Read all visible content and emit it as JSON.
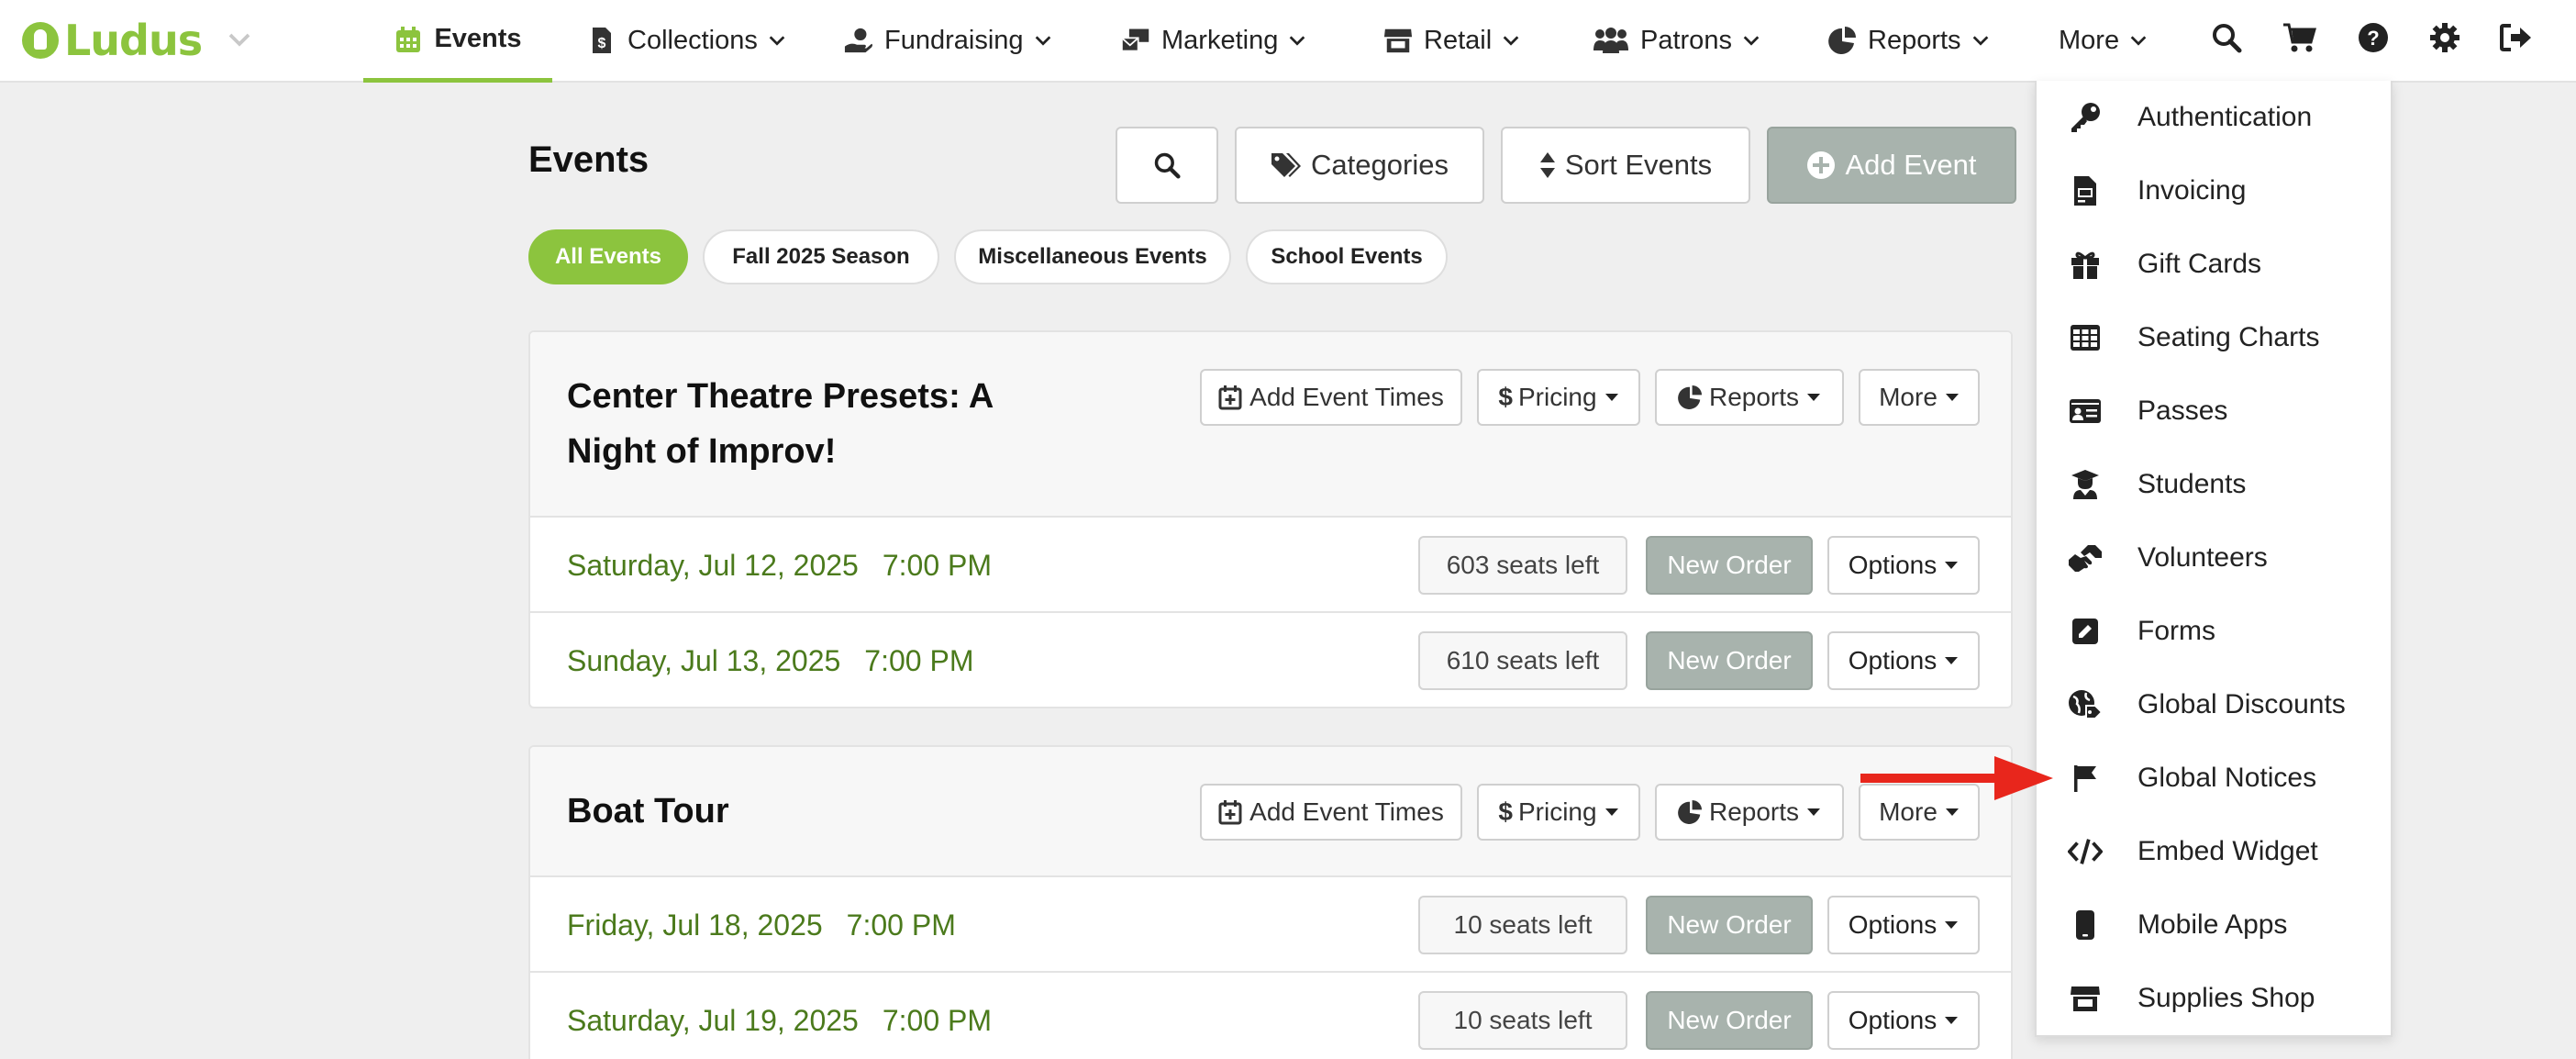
{
  "app": {
    "logo_text": "Ludus"
  },
  "nav": {
    "items": [
      {
        "label": "Events",
        "icon": "calendar-icon",
        "active": true
      },
      {
        "label": "Collections",
        "icon": "file-invoice-dollar-icon"
      },
      {
        "label": "Fundraising",
        "icon": "hand-holding-dollar-icon"
      },
      {
        "label": "Marketing",
        "icon": "mail-bulk-icon"
      },
      {
        "label": "Retail",
        "icon": "store-icon"
      },
      {
        "label": "Patrons",
        "icon": "users-icon"
      },
      {
        "label": "Reports",
        "icon": "chart-pie-icon"
      },
      {
        "label": "More"
      }
    ],
    "right_icons": [
      "search-icon",
      "cart-icon",
      "help-icon",
      "gear-icon",
      "sign-out-icon"
    ]
  },
  "main": {
    "title": "Events",
    "toolbar": {
      "categories": "Categories",
      "sort": "Sort Events",
      "add": "Add Event"
    },
    "filters": [
      "All Events",
      "Fall 2025 Season",
      "Miscellaneous Events",
      "School Events"
    ],
    "card_actions": {
      "add_times": "Add Event Times",
      "pricing": "Pricing",
      "reports": "Reports",
      "more": "More"
    },
    "row_actions": {
      "new_order": "New Order",
      "options": "Options"
    },
    "events": [
      {
        "title_line1": "Center Theatre Presets: A",
        "title_line2": "Night of Improv!",
        "dates": [
          {
            "date": "Saturday, Jul 12, 2025",
            "time": "7:00 PM",
            "seats": "603 seats left"
          },
          {
            "date": "Sunday, Jul 13, 2025",
            "time": "7:00 PM",
            "seats": "610 seats left"
          }
        ]
      },
      {
        "title_line1": "Boat Tour",
        "dates": [
          {
            "date": "Friday, Jul 18, 2025",
            "time": "7:00 PM",
            "seats": "10 seats left"
          },
          {
            "date": "Saturday, Jul 19, 2025",
            "time": "7:00 PM",
            "seats": "10 seats left"
          }
        ]
      }
    ]
  },
  "more_menu": {
    "items": [
      {
        "label": "Authentication",
        "icon": "key-icon"
      },
      {
        "label": "Invoicing",
        "icon": "file-invoice-icon"
      },
      {
        "label": "Gift Cards",
        "icon": "gift-icon"
      },
      {
        "label": "Seating Charts",
        "icon": "table-grid-icon"
      },
      {
        "label": "Passes",
        "icon": "id-card-icon"
      },
      {
        "label": "Students",
        "icon": "graduate-icon"
      },
      {
        "label": "Volunteers",
        "icon": "hands-helping-icon"
      },
      {
        "label": "Forms",
        "icon": "edit-form-icon"
      },
      {
        "label": "Global Discounts",
        "icon": "globe-tag-icon"
      },
      {
        "label": "Global Notices",
        "icon": "flag-icon"
      },
      {
        "label": "Embed Widget",
        "icon": "code-icon"
      },
      {
        "label": "Mobile Apps",
        "icon": "mobile-icon"
      },
      {
        "label": "Supplies Shop",
        "icon": "shop-icon"
      }
    ]
  },
  "colors": {
    "brand": "#8cc43e",
    "date_text": "#4b7a1c",
    "disabled": "#a8b3ad",
    "annotation_arrow": "#e8261c"
  }
}
